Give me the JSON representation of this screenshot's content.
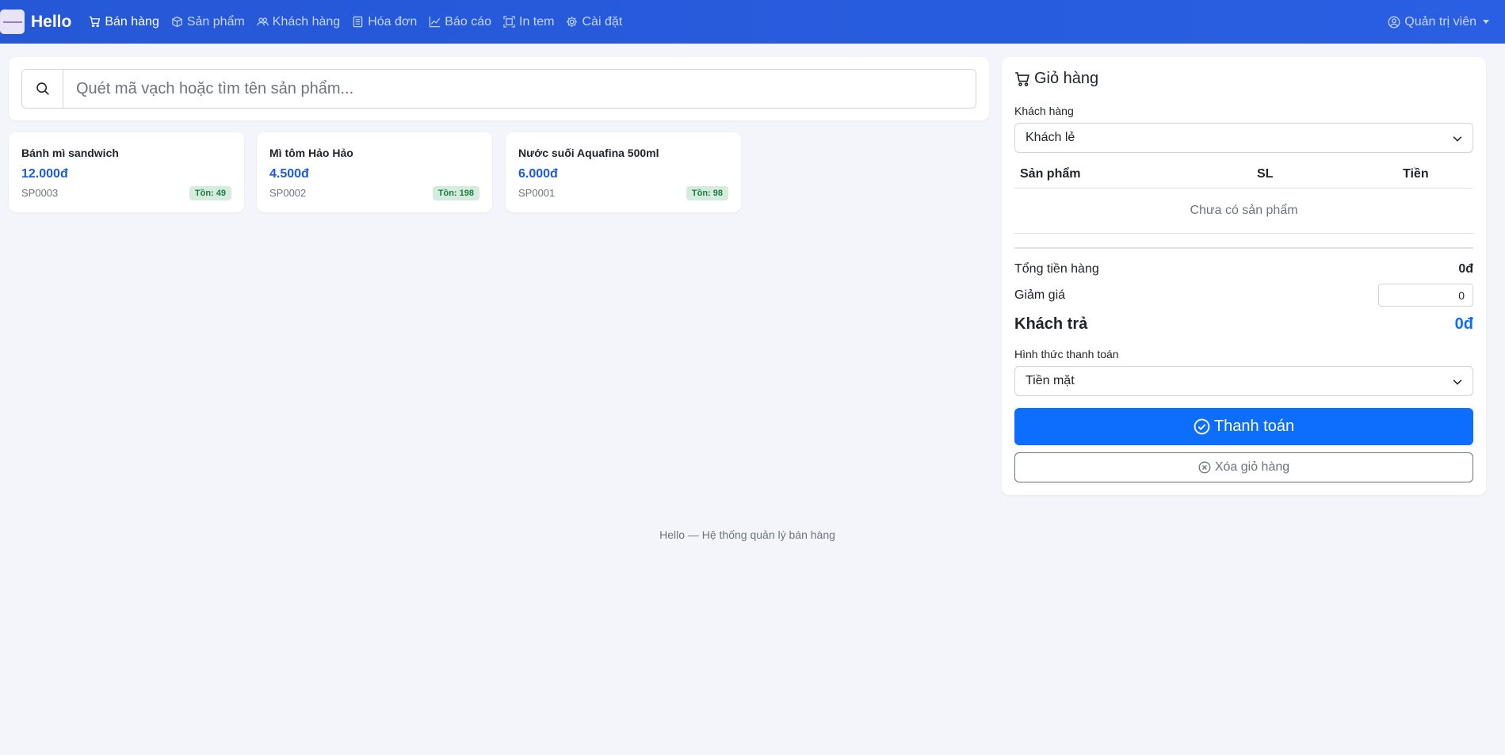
{
  "navbar": {
    "brand": "Hello",
    "items": [
      {
        "label": "Bán hàng",
        "icon": "cart-icon",
        "active": true
      },
      {
        "label": "Sản phẩm",
        "icon": "box-icon",
        "active": false
      },
      {
        "label": "Khách hàng",
        "icon": "people-icon",
        "active": false
      },
      {
        "label": "Hóa đơn",
        "icon": "receipt-icon",
        "active": false
      },
      {
        "label": "Báo cáo",
        "icon": "chart-line-icon",
        "active": false
      },
      {
        "label": "In tem",
        "icon": "barcode-scan-icon",
        "active": false
      },
      {
        "label": "Cài đặt",
        "icon": "gear-icon",
        "active": false
      }
    ],
    "user": {
      "label": "Quản trị viên",
      "icon": "user-circle-icon"
    }
  },
  "search": {
    "placeholder": "Quét mã vạch hoặc tìm tên sản phẩm...",
    "value": ""
  },
  "products": [
    {
      "name": "Bánh mì sandwich",
      "price": "12.000đ",
      "sku": "SP0003",
      "stock": "Tồn: 49"
    },
    {
      "name": "Mì tôm Hảo Hảo",
      "price": "4.500đ",
      "sku": "SP0002",
      "stock": "Tồn: 198"
    },
    {
      "name": "Nước suối Aquafina 500ml",
      "price": "6.000đ",
      "sku": "SP0001",
      "stock": "Tồn: 98"
    }
  ],
  "cart": {
    "title": "Giỏ hàng",
    "customer_label": "Khách hàng",
    "customer_value": "Khách lẻ",
    "columns": [
      "Sản phẩm",
      "SL",
      "Tiền"
    ],
    "empty_text": "Chưa có sản phẩm",
    "subtotal_label": "Tổng tiền hàng",
    "subtotal_value": "0đ",
    "discount_label": "Giảm giá",
    "discount_value": "0",
    "total_label": "Khách trả",
    "total_value": "0đ",
    "payment_label": "Hình thức thanh toán",
    "payment_value": "Tiền mặt",
    "pay_button": "Thanh toán",
    "clear_button": "Xóa giỏ hàng"
  },
  "footer": "Hello — Hệ thống quản lý bán hàng",
  "colors": {
    "navbar": "#2a5fe3",
    "primary": "#0d6efd",
    "price": "#1d5ad8",
    "badge_bg": "#d3ecdc",
    "badge_text": "#1f7a45"
  }
}
